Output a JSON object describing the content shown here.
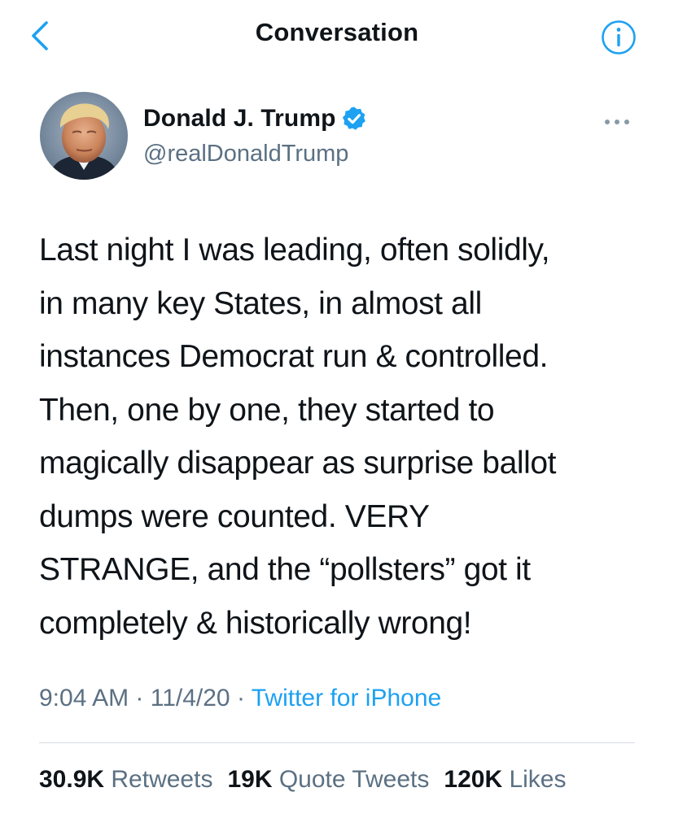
{
  "header": {
    "title": "Conversation",
    "back_icon": "chevron-left-icon",
    "info_icon": "info-circle-icon",
    "accent_color": "#1da1f2"
  },
  "tweet": {
    "author": {
      "display_name": "Donald J. Trump",
      "handle": "@realDonaldTrump",
      "verified": true,
      "verified_color": "#1da1f2"
    },
    "text_lines": [
      "Last night I was leading, often solidly,",
      "in many key States, in almost all",
      "instances Democrat run & controlled.",
      "Then, one by one, they started to",
      "magically disappear as surprise ballot",
      "dumps were counted. VERY",
      "STRANGE, and the “pollsters” got it",
      "completely & historically wrong!"
    ],
    "time": "9:04 AM",
    "date": "11/4/20",
    "separator": "·",
    "source": "Twitter for iPhone"
  },
  "stats": {
    "retweets": {
      "count": "30.9K",
      "label": "Retweets"
    },
    "quote_tweets": {
      "count": "19K",
      "label": "Quote Tweets"
    },
    "likes": {
      "count": "120K",
      "label": "Likes"
    }
  }
}
